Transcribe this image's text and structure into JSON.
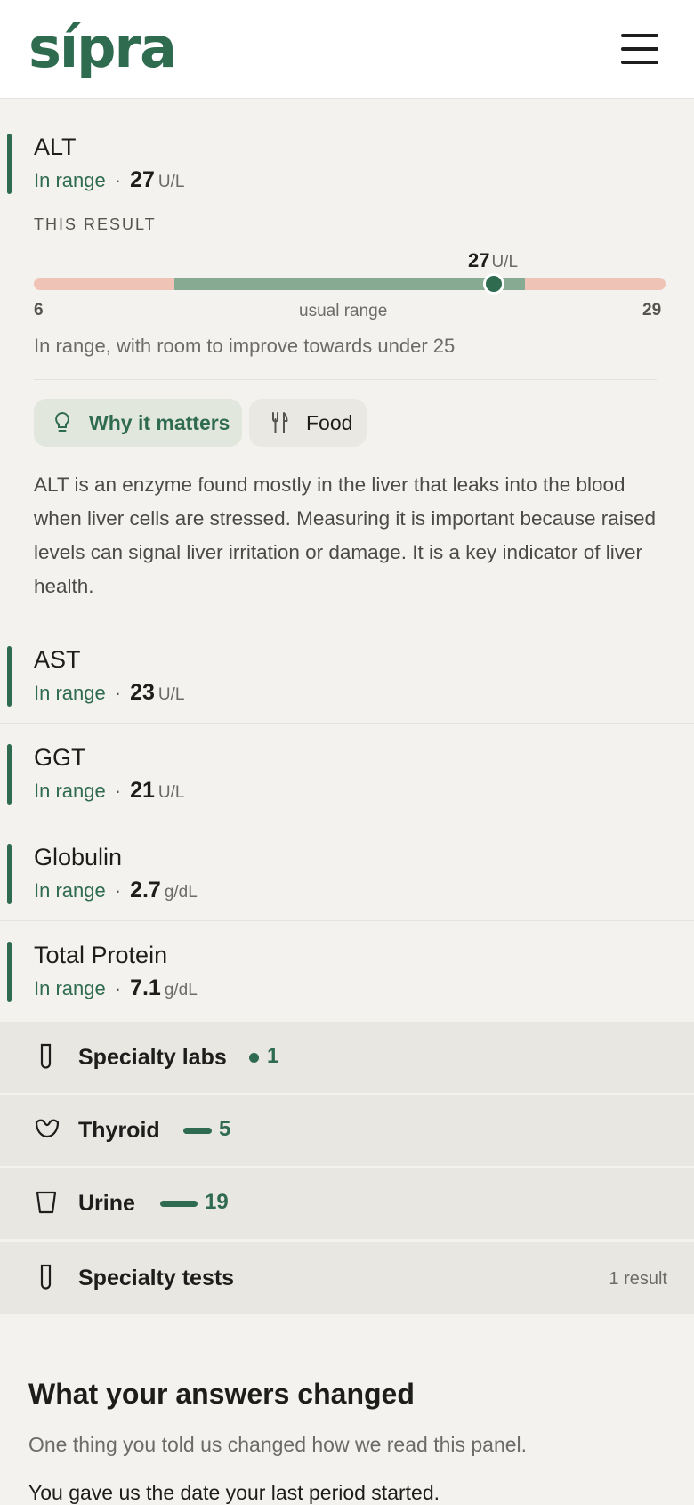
{
  "header": {
    "logo": "sípra"
  },
  "alt": {
    "name": "ALT",
    "status": "In range",
    "value": "27",
    "unit": "U/L",
    "this_result_label": "THIS RESULT",
    "range_min": "6",
    "range_max": "29",
    "range_label": "usual range",
    "range_note": "In range, with room to improve towards under 25",
    "tabs": {
      "why": "Why it matters",
      "food": "Food"
    },
    "description": "ALT is an enzyme found mostly in the liver that leaks into the blood when liver cells are stressed. Measuring it is important because raised levels can signal liver irritation or damage. It is a key indicator of liver health."
  },
  "markers": [
    {
      "name": "AST",
      "status": "In range",
      "value": "23",
      "unit": "U/L"
    },
    {
      "name": "GGT",
      "status": "In range",
      "value": "21",
      "unit": "U/L"
    },
    {
      "name": "Globulin",
      "status": "In range",
      "value": "2.7",
      "unit": "g/dL"
    },
    {
      "name": "Total Protein",
      "status": "In range",
      "value": "7.1",
      "unit": "g/dL"
    }
  ],
  "categories": [
    {
      "name": "Specialty labs",
      "count": "1",
      "icon": "test-tube-icon"
    },
    {
      "name": "Thyroid",
      "count": "5",
      "icon": "thyroid-icon"
    },
    {
      "name": "Urine",
      "count": "19",
      "icon": "cup-icon"
    },
    {
      "name": "Specialty tests",
      "result": "1 result",
      "icon": "test-tube-icon"
    }
  ],
  "answers": {
    "title": "What your answers changed",
    "subtitle": "One thing you told us changed how we read this panel.",
    "line": "You gave us the date your last period started."
  },
  "colors": {
    "accent": "#2f6b4f",
    "range_ok": "#87aa92",
    "range_out": "#efc3b6",
    "background": "#f4f2ee"
  }
}
